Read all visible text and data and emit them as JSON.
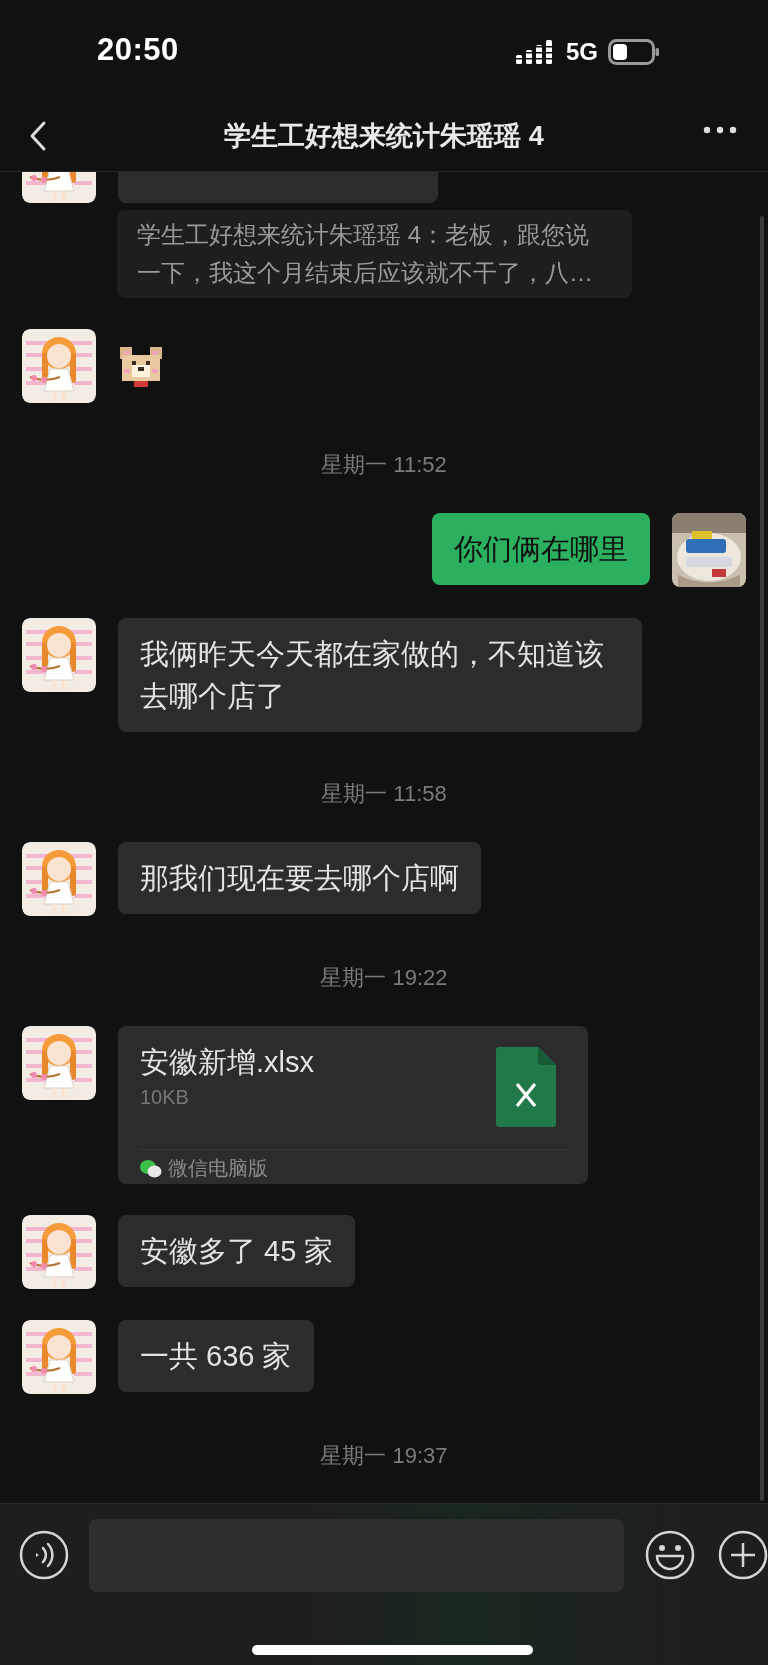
{
  "status_bar": {
    "time": "20:50",
    "network": "5G"
  },
  "header": {
    "title": "学生工好想来统计朱瑶瑶 4"
  },
  "messages": [
    {
      "kind": "partial",
      "outgoing": false
    },
    {
      "kind": "quote",
      "outgoing": false,
      "text": "学生工好想来统计朱瑶瑶 4：老板，跟您说一下，我这个月结束后应该就不干了，八…"
    },
    {
      "kind": "sticker",
      "outgoing": false
    },
    {
      "kind": "time",
      "text": "星期一 11:52"
    },
    {
      "kind": "text",
      "outgoing": true,
      "text": "你们俩在哪里"
    },
    {
      "kind": "text",
      "outgoing": false,
      "text": "我俩昨天今天都在家做的，不知道该去哪个店了"
    },
    {
      "kind": "time",
      "text": "星期一 11:58"
    },
    {
      "kind": "text",
      "outgoing": false,
      "text": "那我们现在要去哪个店啊"
    },
    {
      "kind": "time",
      "text": "星期一 19:22"
    },
    {
      "kind": "file",
      "outgoing": false,
      "name": "安徽新增.xlsx",
      "size": "10KB",
      "source": "微信电脑版"
    },
    {
      "kind": "text",
      "outgoing": false,
      "text": "安徽多了 45 家"
    },
    {
      "kind": "text",
      "outgoing": false,
      "text": "一共 636 家"
    },
    {
      "kind": "time",
      "text": "星期一 19:37"
    }
  ]
}
